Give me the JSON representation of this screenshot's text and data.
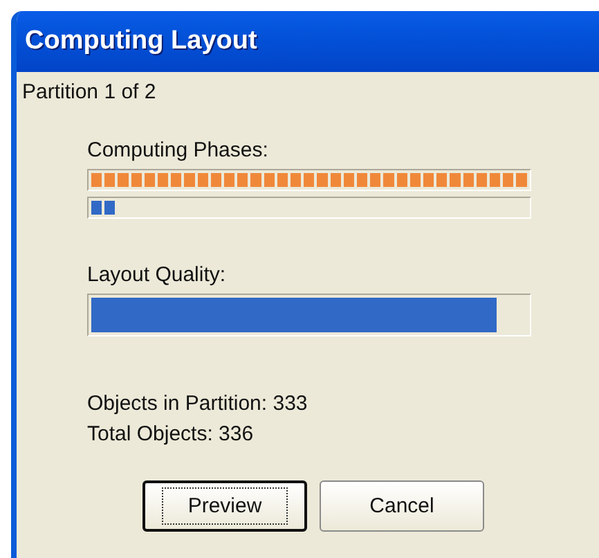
{
  "window": {
    "title": "Computing Layout"
  },
  "partition": "Partition 1 of 2",
  "progress": [
    {
      "label": "Computing Phases:",
      "kind": "segmented",
      "bars": [
        {
          "color": "#f0883a",
          "level": 1
        },
        {
          "color": "#3169c6",
          "level": 0.06
        }
      ]
    },
    {
      "label": "Layout Quality:",
      "kind": "solid",
      "bars": [
        {
          "color": "#3169c6",
          "level": 0.93
        }
      ]
    }
  ],
  "stats": [
    "Objects in Partition: 333",
    "Total Objects: 336"
  ],
  "buttons": [
    {
      "label": "Preview",
      "default": true
    },
    {
      "label": "Cancel",
      "default": false
    }
  ]
}
